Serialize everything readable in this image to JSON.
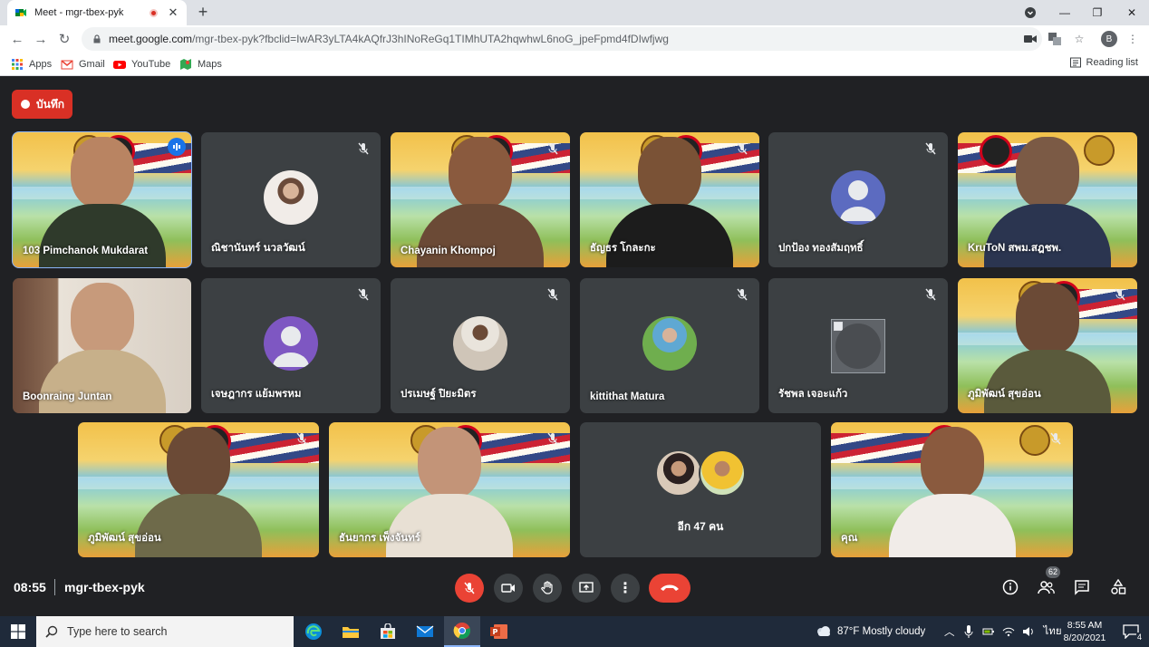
{
  "browser": {
    "tab_title": "Meet - mgr-tbex-pyk",
    "url_host": "meet.google.com",
    "url_path": "/mgr-tbex-pyk?fbclid=IwAR3yLTA4kAQfrJ3hINoReGq1TIMhUTA2hqwhwL6noG_jpeFpmd4fDIwfjwg",
    "profile_initial": "B",
    "bookmarks": [
      "Apps",
      "Gmail",
      "YouTube",
      "Maps"
    ],
    "reading_list": "Reading list"
  },
  "meet": {
    "record_label": "บันทึก",
    "participants": [
      {
        "name": "103 Pimchanok Mukdarat",
        "muted": false,
        "speaking": true,
        "kind": "camera"
      },
      {
        "name": "ณิชานันทร์ นวลวัฒน์",
        "muted": true,
        "kind": "avatar-photo"
      },
      {
        "name": "Chayanin Khompoj",
        "muted": true,
        "kind": "camera"
      },
      {
        "name": "ธัญธร โกละกะ",
        "muted": true,
        "kind": "camera"
      },
      {
        "name": "ปกป้อง ทองสัมฤทธิ์",
        "muted": true,
        "kind": "avatar-default"
      },
      {
        "name": "KruToN สพม.สฎชพ.",
        "muted": false,
        "kind": "camera"
      },
      {
        "name": "Boonraing Juntan",
        "muted": false,
        "kind": "camera"
      },
      {
        "name": "เจษฎากร แย้มพรหม",
        "muted": true,
        "kind": "avatar-default"
      },
      {
        "name": "ปรเมษฐ์ ปิยะมิตร",
        "muted": true,
        "kind": "avatar-photo"
      },
      {
        "name": "kittithat Matura",
        "muted": true,
        "kind": "avatar-photo"
      },
      {
        "name": "รัชพล เจอะแก้ว",
        "muted": true,
        "kind": "avatar-broken"
      },
      {
        "name": "ภูมิพัฒน์ สุขอ่อน",
        "muted": true,
        "kind": "camera"
      },
      {
        "name": "ภูมิพัฒน์ สุขอ่อน",
        "muted": true,
        "kind": "camera"
      },
      {
        "name": "ธันยากร เพ็งจันทร์",
        "muted": true,
        "kind": "camera"
      },
      {
        "name": "คุณ",
        "muted": true,
        "kind": "camera"
      }
    ],
    "more_label": "อีก 47 คน",
    "clock": "08:55",
    "meeting_code": "mgr-tbex-pyk",
    "people_count": "62"
  },
  "taskbar": {
    "search_placeholder": "Type here to search",
    "weather": "87°F  Mostly cloudy",
    "lang": "ไทย",
    "time": "8:55 AM",
    "date": "8/20/2021",
    "notif_count": "4"
  },
  "colors": {
    "meet_bg": "#202124",
    "tile_bg": "#3c4043",
    "record_red": "#d93025",
    "hangup_red": "#ea4335",
    "speaking_blue": "#8ab4f8"
  }
}
